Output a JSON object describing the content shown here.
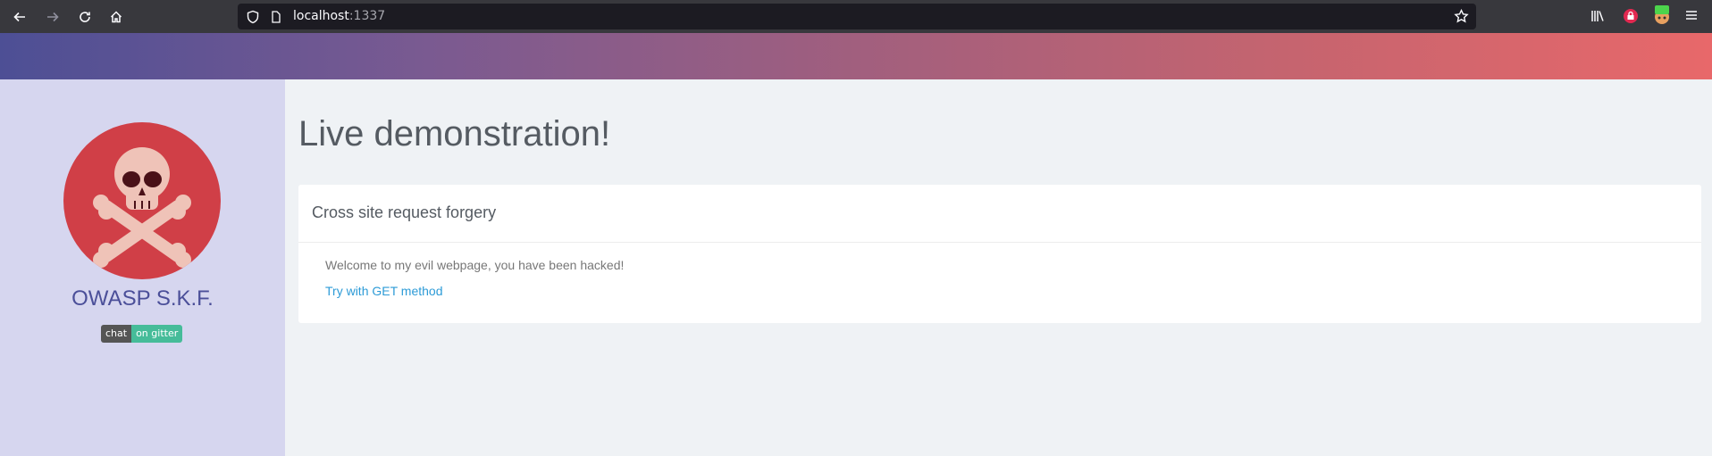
{
  "browser": {
    "url_host": "localhost",
    "url_port": ":1337"
  },
  "sidebar": {
    "brand": "OWASP S.K.F.",
    "badge": {
      "left": "chat",
      "right": "on gitter"
    }
  },
  "main": {
    "title": "Live demonstration!",
    "card": {
      "header": "Cross site request forgery",
      "message": "Welcome to my evil webpage, you have been hacked!",
      "link": "Try with GET method"
    }
  },
  "colors": {
    "gradient_start": "#4d4f95",
    "gradient_end": "#e8686a",
    "sidebar_bg": "#d6d6ef",
    "logo_bg": "#d03f47",
    "link": "#2d9bd7"
  },
  "icons": [
    "back-icon",
    "forward-icon",
    "reload-icon",
    "home-icon",
    "shield-icon",
    "page-icon",
    "bookmark-star-icon",
    "library-icon",
    "lock-extension-icon",
    "burp-extension-icon",
    "menu-icon",
    "skull-crossbones-icon"
  ]
}
